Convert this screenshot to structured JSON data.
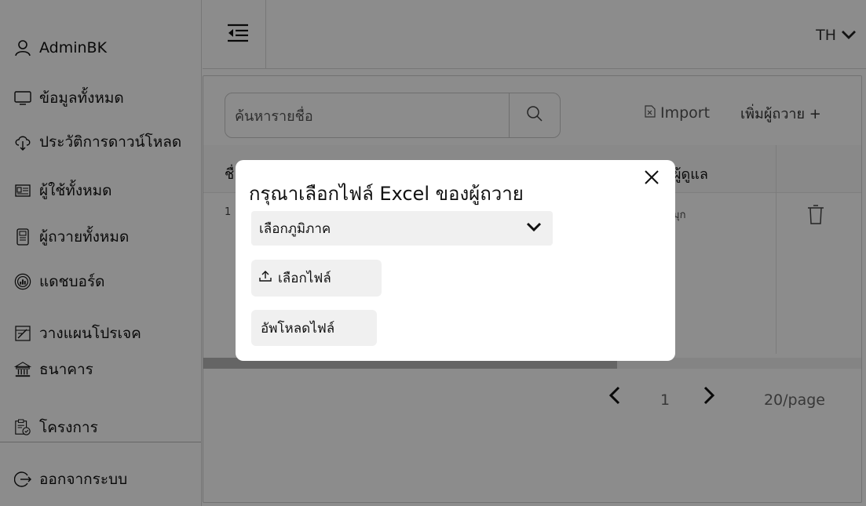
{
  "sidebar": {
    "user": "AdminBK",
    "items": [
      {
        "label": "ข้อมูลทั้งหมด",
        "icon": "monitor-icon"
      },
      {
        "label": "ประวัติการดาวน์โหลด",
        "icon": "cloud-download-icon"
      },
      {
        "label": "ผู้ใช้ทั้งหมด",
        "icon": "id-card-icon"
      },
      {
        "label": "ผู้ถวายทั้งหมด",
        "icon": "document-icon"
      },
      {
        "label": "แดชบอร์ด",
        "icon": "dashboard-icon"
      },
      {
        "label": "วางแผนโปรเจค",
        "icon": "project-plan-icon"
      },
      {
        "label": "ธนาคาร",
        "icon": "bank-icon"
      },
      {
        "label": "โครงการ",
        "icon": "project-icon"
      }
    ],
    "logout": "ออกจากระบบ"
  },
  "header": {
    "language": "TH"
  },
  "main": {
    "search_placeholder": "ค้นหารายชื่อ",
    "import_label": "Import",
    "add_label": "เพิ่มผู้ถวาย +",
    "table": {
      "headers": [
        "ชื่",
        "ผู้ดูแล"
      ],
      "row": {
        "first_cell": "1",
        "caretaker": "มุก"
      }
    },
    "pagination": {
      "current_page": "1",
      "page_size": "20/page"
    }
  },
  "modal": {
    "title": "กรุณาเลือกไฟล์ Excel ของผู้ถวาย",
    "select_placeholder": "เลือกภูมิภาค",
    "choose_file": "เลือกไฟล์",
    "upload": "อัพโหลดไฟล์"
  },
  "colors": {
    "overlay": "#000000",
    "modal_bg": "#ffffff",
    "control_bg": "#f0f0f0"
  }
}
